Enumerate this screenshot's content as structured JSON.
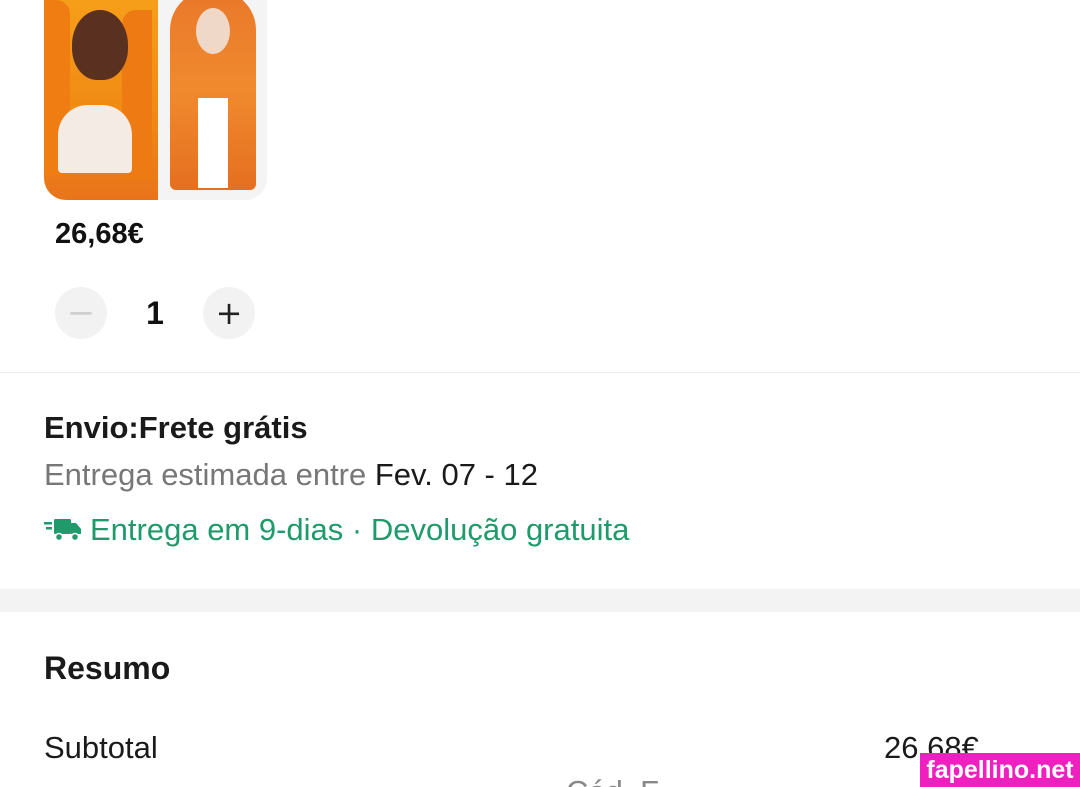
{
  "product": {
    "price": "26,68€",
    "quantity": "1",
    "image_alt": "Peruca laranja longa"
  },
  "stepper": {
    "minus_symbol": "−",
    "plus_symbol": "+"
  },
  "shipping": {
    "title": "Envio:Frete grátis",
    "eta_prefix": "Entrega estimada entre ",
    "eta_date": "Fev. 07 - 12",
    "delivery_note": "Entrega em 9-dias · Devolução gratuita",
    "accent_color": "#1f9a6b",
    "icon": "truck-icon"
  },
  "summary": {
    "title": "Resumo",
    "subtotal_label": "Subtotal",
    "subtotal_value": "26,68€",
    "partial_line": "Cód. F"
  },
  "watermark": {
    "text": "fapellino.net",
    "color": "#f01fbf"
  }
}
